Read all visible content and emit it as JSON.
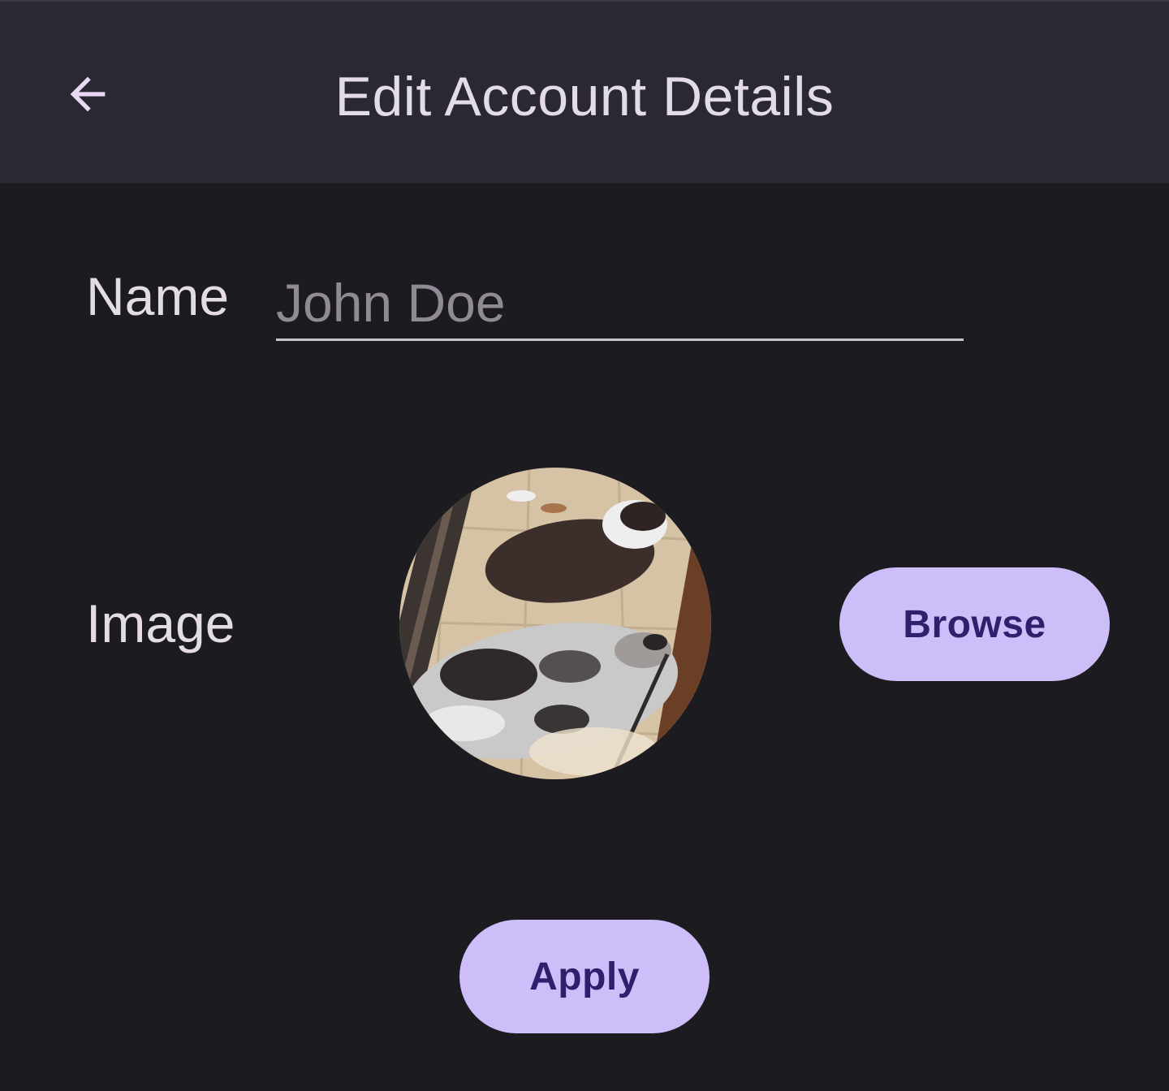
{
  "header": {
    "title": "Edit Account Details",
    "back_icon": "arrow-back-icon"
  },
  "form": {
    "name_label": "Name",
    "name_placeholder": "John Doe",
    "name_value": "",
    "image_label": "Image"
  },
  "actions": {
    "browse_label": "Browse",
    "apply_label": "Apply"
  },
  "colors": {
    "background": "#1c1b20",
    "app_bar": "#2a2833",
    "button_fill": "#cdbdf9",
    "button_text": "#2f1f6c",
    "text": "#e3dce6"
  }
}
